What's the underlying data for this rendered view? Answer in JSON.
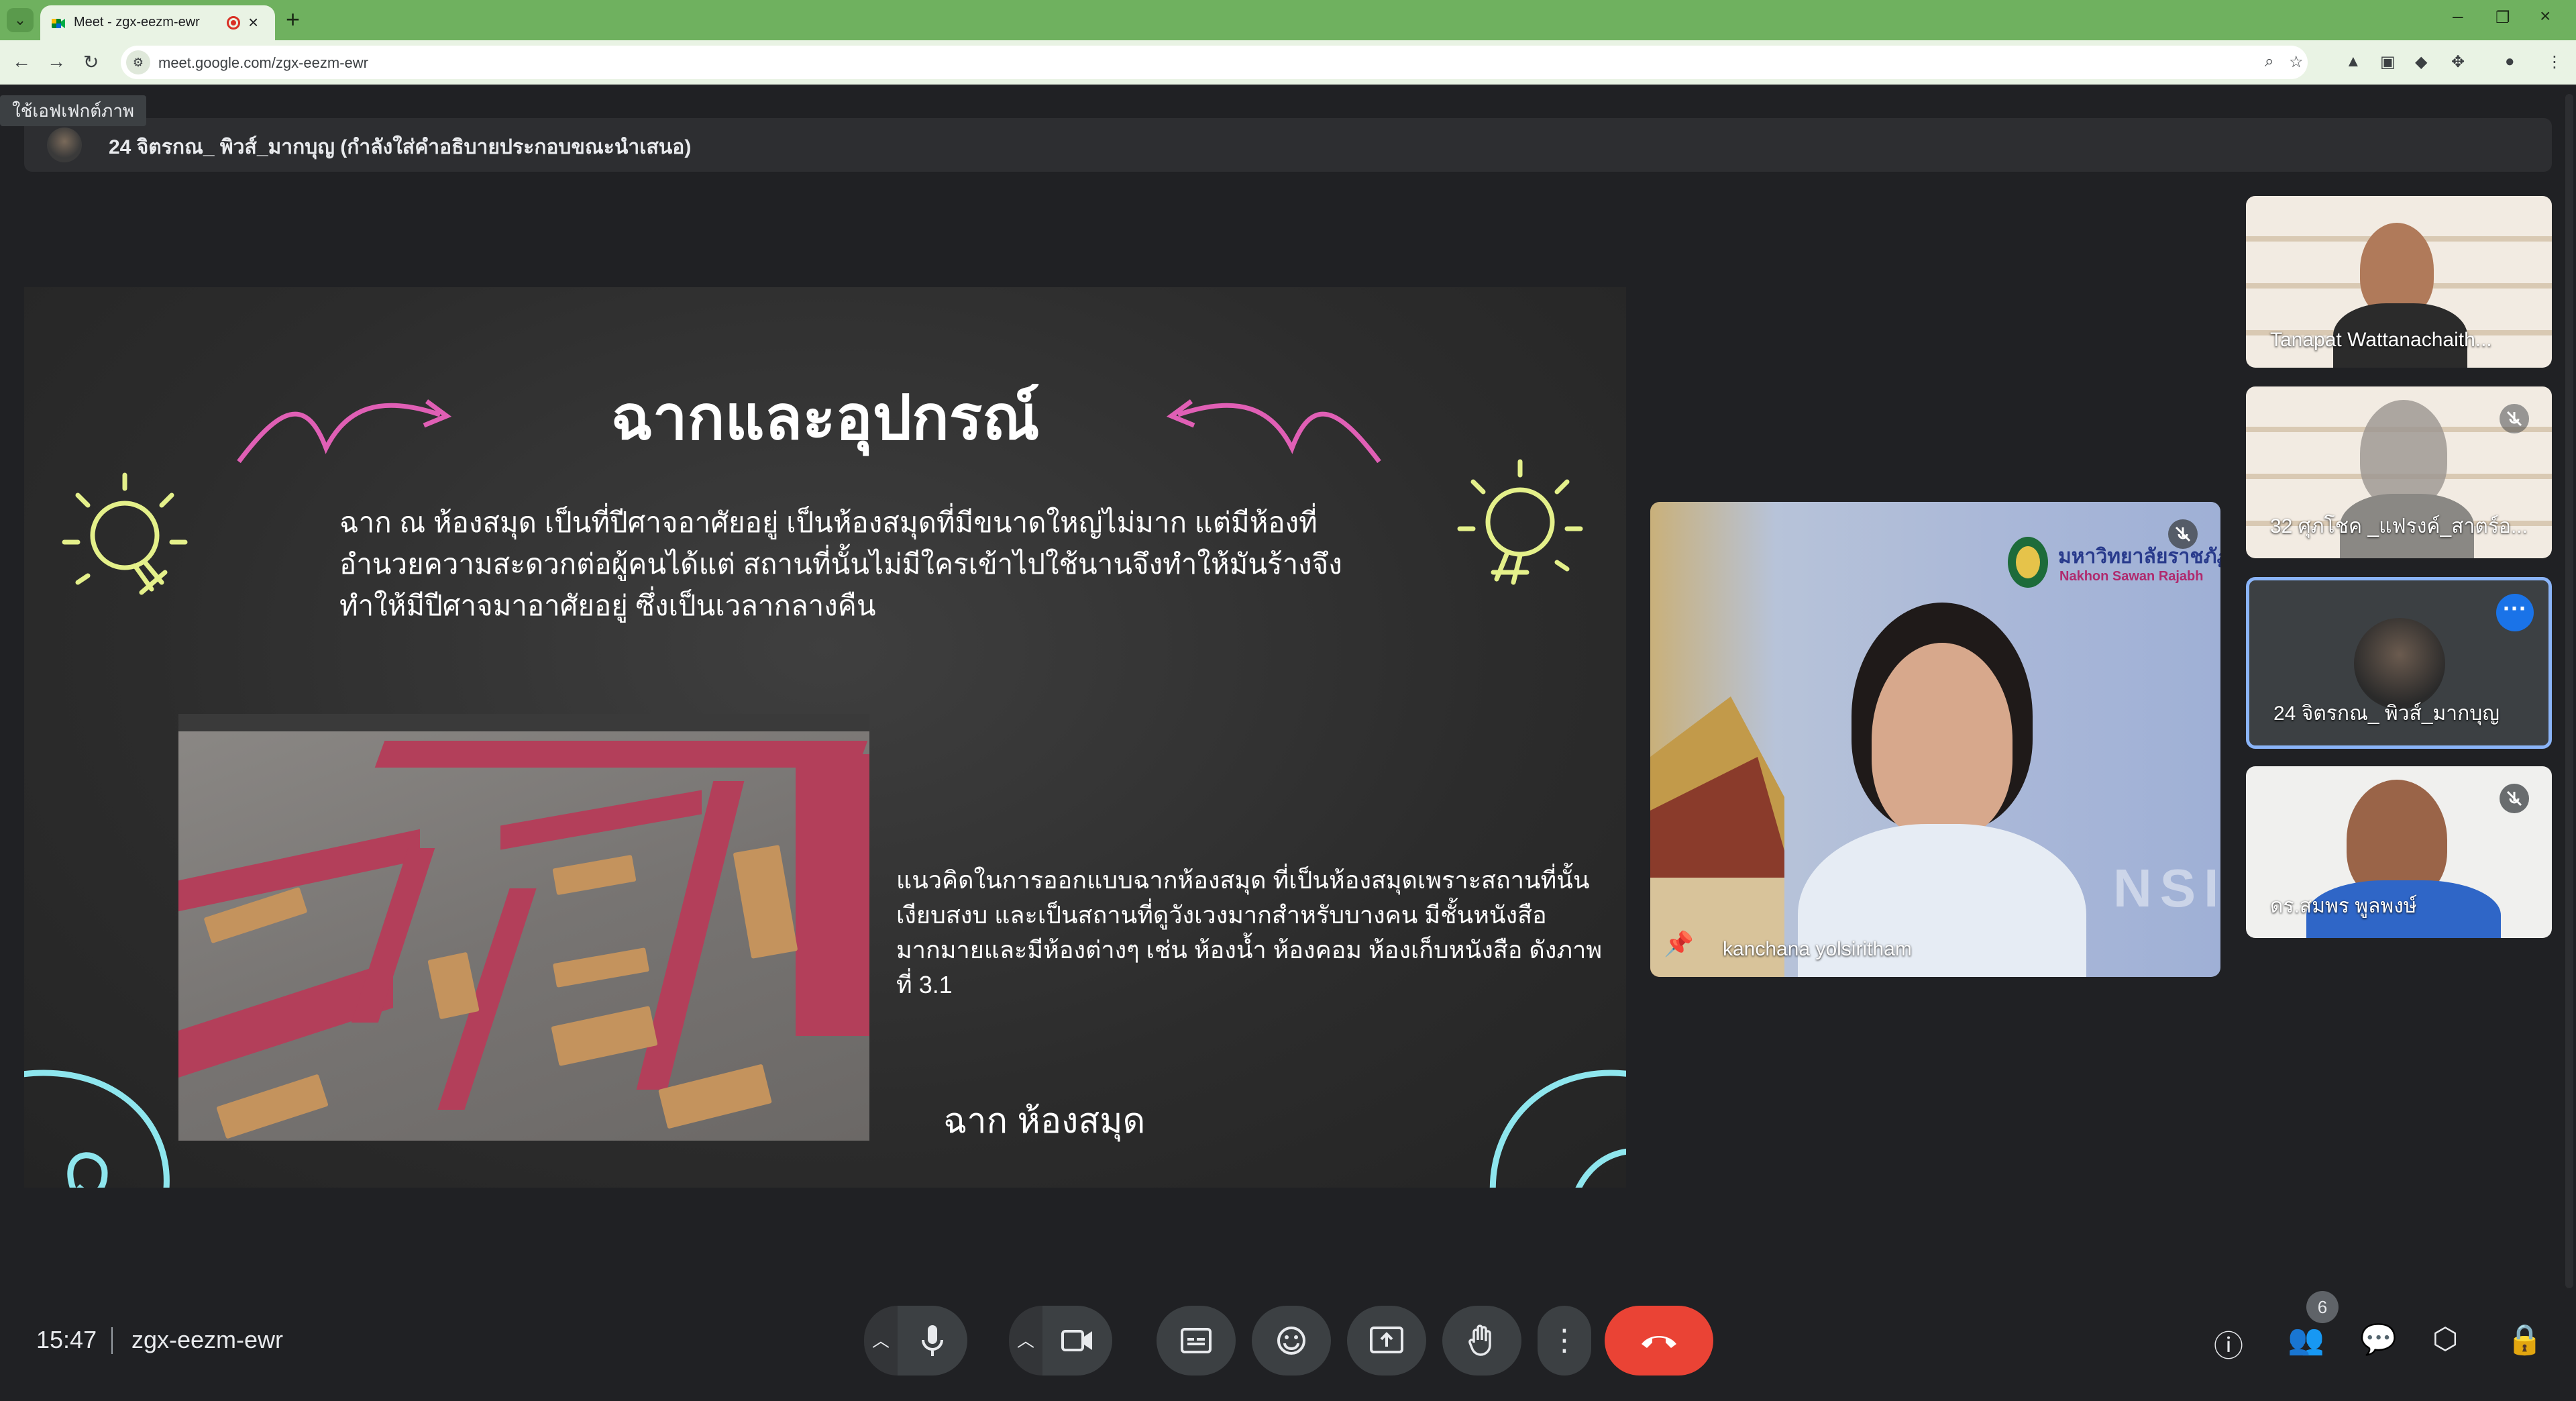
{
  "browser": {
    "tab_title": "Meet - zgx-eezm-ewr",
    "url": "meet.google.com/zgx-eezm-ewr",
    "accent": "#6fb15f"
  },
  "meet": {
    "tooltip": "ใช้เอฟเฟกต์ภาพ",
    "presenter_banner": "24 จิตรกณ_ พิวส์_มากบุญ (กำลังใส่คำอธิบายประกอบขณะนำเสนอ)",
    "slide": {
      "title": "ฉากและอุปกรณ์",
      "paragraph1": "ฉาก ณ ห้องสมุด เป็นที่ปีศาจอาศัยอยู่ เป็นห้องสมุดที่มีขนาดใหญ่ไม่มาก แต่มีห้องที่อำนวยความสะดวกต่อผู้คนได้แต่ สถานที่นั้นไม่มีใครเข้าไปใช้นานจึงทำให้มันร้างจึงทำให้มีปีศาจมาอาศัยอยู่ ซึ่งเป็นเวลากลางคืน",
      "paragraph2": "แนวคิดในการออกแบบฉากห้องสมุด ที่เป็นห้องสมุดเพราะสถานที่นั้นเงียบสงบ และเป็นสถานที่ดูวังเวงมากสำหรับบางคน มีชั้นหนังสือมากมายและมีห้องต่างๆ เช่น ห้องน้ำ ห้องคอม ห้องเก็บหนังสือ  ดังภาพที่ 3.1",
      "caption": "ฉาก ห้องสมุด"
    },
    "participants": [
      {
        "name": "Tanapat Wattanachaith..."
      },
      {
        "name": "32 ศุภโชค _แฟรงค์_สาตร์อ..."
      },
      {
        "name": "24 จิตรกณ_ พิวส์_มากบุญ"
      },
      {
        "name": "ดร.สมพร พูลพงษ์"
      }
    ],
    "pinned": {
      "name": "kanchana yolsiritham",
      "backdrop_text1": "มหาวิทยาลัยราชภัฏ",
      "backdrop_text2": "Nakhon Sawan Rajabh",
      "backdrop_text3": "NSI"
    },
    "time": "15:47",
    "meeting_code": "zgx-eezm-ewr",
    "people_count": "6"
  }
}
